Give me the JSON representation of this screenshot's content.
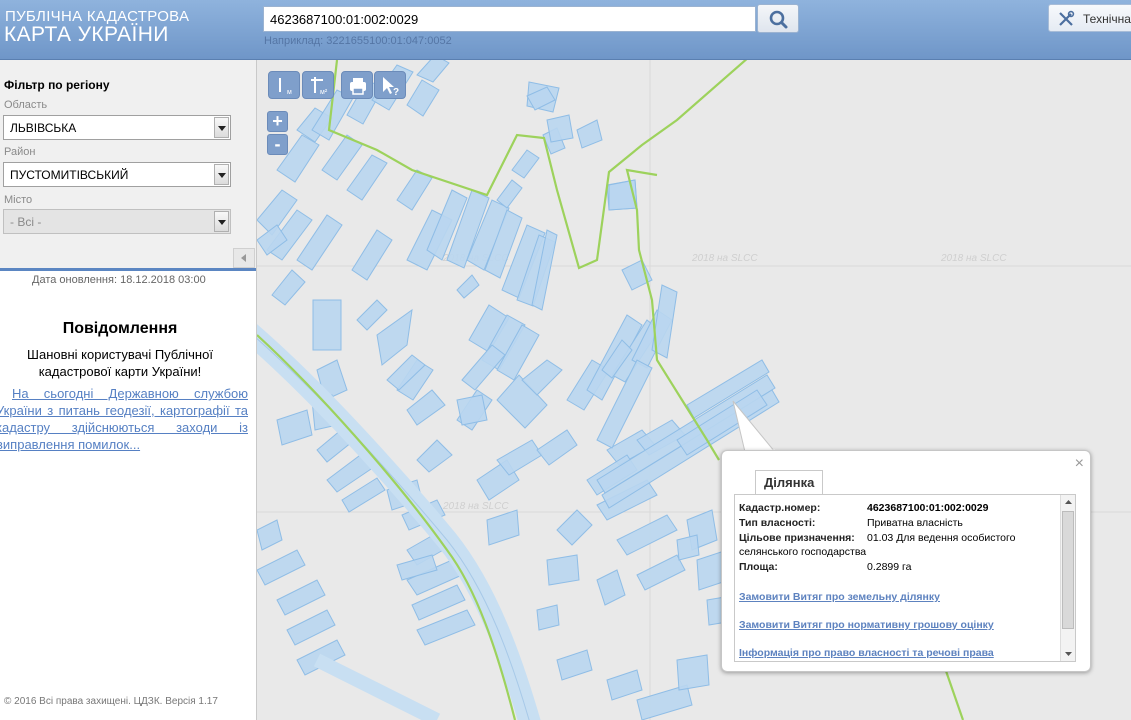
{
  "header": {
    "logo_line1": "ПУБЛІЧНА КАДАСТРОВА",
    "logo_line2": "КАРТА УКРАЇНИ",
    "search_value": "4623687100:01:002:0029",
    "search_hint": "Наприклад: 3221655100:01:047:0052",
    "tech_button_label": "Технічна"
  },
  "sidebar": {
    "filter_title": "Фільтр по регіону",
    "region_label": "Область",
    "region_value": "ЛЬВІВСЬКА",
    "district_label": "Район",
    "district_value": "ПУСТОМИТІВСЬКИЙ",
    "city_label": "Місто",
    "city_value": "- Всі -",
    "update_date": "Дата оновлення: 18.12.2018 03:00",
    "notice_title": "Повідомлення",
    "notice_text": "Шановні користувачі Публічної кадастрової карти України!",
    "notice_link": "На сьогодні Державною службою України з питань геодезії, картографії та кадастру здійснюються заходи із виправлення помилок...",
    "copyright": "© 2016 Всі права захищені. ЦДЗК. Версія 1.17"
  },
  "map": {
    "watermark": "2018 на SLCC",
    "colors": {
      "background": "#e9e9e9",
      "parcel_fill": "#b9d6f0",
      "parcel_stroke": "#8fbde6",
      "boundary": "#9dd25c"
    },
    "toolbar_icons": [
      "ruler-icon",
      "area-measure-icon",
      "print-icon",
      "identify-cursor-icon"
    ],
    "zoom_in": "+",
    "zoom_out": "-"
  },
  "popup": {
    "tab_label": "Ділянка",
    "close": "×",
    "rows": [
      {
        "key": "Кадастр.номер:",
        "value": "4623687100:01:002:0029"
      },
      {
        "key": "Тип власності:",
        "value": "Приватна власність"
      },
      {
        "key": "Цільове призначення:",
        "value": "01.03 Для ведення особистого"
      },
      {
        "key": "",
        "value": "селянського господарства"
      },
      {
        "key": "Площа:",
        "value": "0.2899 га"
      }
    ],
    "links": [
      "Замовити Витяг про земельну ділянку",
      "Замовити Витяг про нормативну грошову оцінку",
      "Інформація про право власності та речові права"
    ]
  }
}
